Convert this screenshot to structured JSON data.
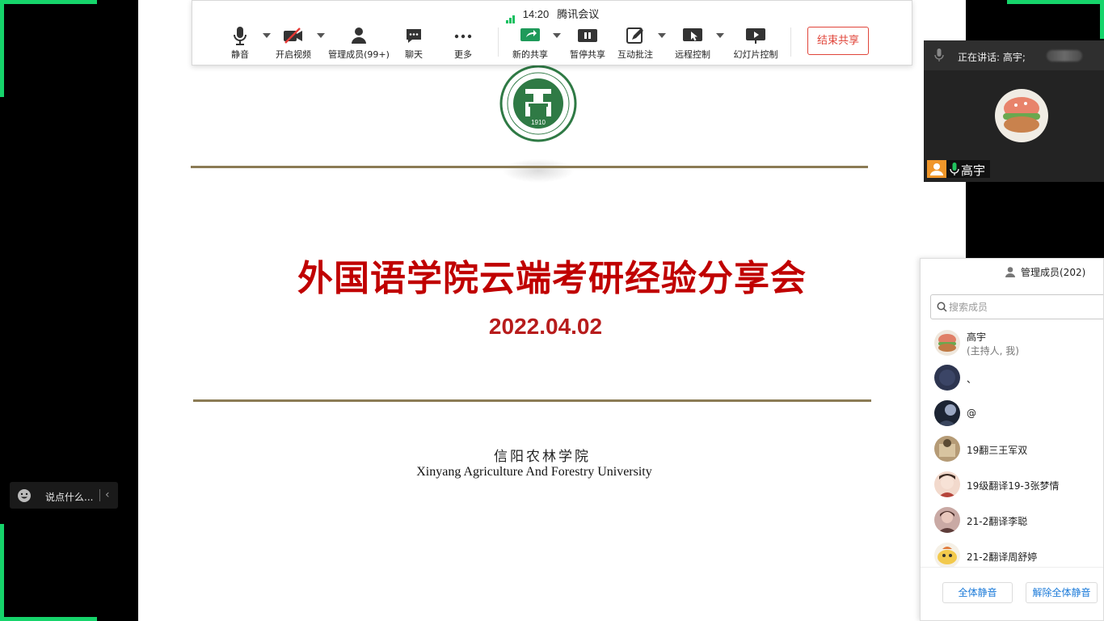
{
  "app": {
    "name": "腾讯会议",
    "time": "14:20"
  },
  "colors": {
    "accent_green": "#16d46b",
    "title_red": "#c00000",
    "end_share_red": "#e0453a",
    "link_blue": "#1a7ad9",
    "rule_gold": "#8b7b55"
  },
  "toolbar": {
    "mute": "静音",
    "video": "开启视频",
    "members": "管理成员(99+)",
    "chat": "聊天",
    "more": "更多",
    "new_share": "新的共享",
    "pause_share": "暂停共享",
    "annotate": "互动批注",
    "remote": "远程控制",
    "slideshow": "幻灯片控制",
    "end_share": "结束共享",
    "icons": [
      "mic-icon",
      "camera-off-icon",
      "person-icon",
      "chat-icon",
      "more-icon",
      "share-icon",
      "pause-icon",
      "annotate-icon",
      "remote-control-icon",
      "slideshow-icon"
    ]
  },
  "slide": {
    "logo_year": "1910",
    "title": "外国语学院云端考研经验分享会",
    "date": "2022.04.02",
    "university_cn": "信阳农林学院",
    "university_en": "Xinyang Agriculture And Forestry University"
  },
  "speaker": {
    "label": "正在讲话: 高宇;",
    "name": "高宇"
  },
  "chat": {
    "placeholder": "说点什么..."
  },
  "members_panel": {
    "title": "管理成员(202)",
    "search_placeholder": "搜索成员",
    "members": [
      {
        "name": "高宇",
        "sub": "(主持人, 我)"
      },
      {
        "name": "、"
      },
      {
        "name": "@"
      },
      {
        "name": "19翻三王军双"
      },
      {
        "name": "19级翻译19-3张梦情"
      },
      {
        "name": "21-2翻译李聪"
      },
      {
        "name": "21-2翻译周舒婷"
      }
    ],
    "mute_all": "全体静音",
    "unmute_all": "解除全体静音"
  }
}
